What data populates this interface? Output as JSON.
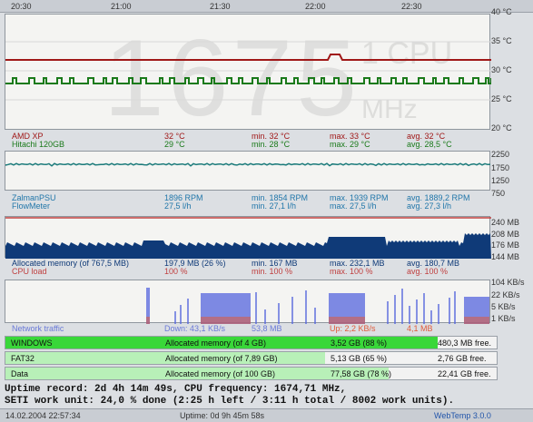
{
  "window": {
    "app_name": "WebTemp 3.0.0"
  },
  "time_axis": [
    "20:30",
    "21:00",
    "21:30",
    "22:00",
    "22:30"
  ],
  "colors": {
    "temp_amd": "#a01818",
    "temp_hitachi": "#1a7a1a",
    "fan": "#1a7a7a",
    "memory_fill": "#0f3a78",
    "cpu_load": "#c04040",
    "net_down": "#5566dd",
    "net_up": "#e05a3a",
    "drive_windows": "#39d739",
    "drive_fat32": "#b8f0b8",
    "drive_data": "#b8f0b8"
  },
  "temperature": {
    "scale": [
      "40 °C",
      "35 °C",
      "30 °C",
      "25 °C",
      "20 °C"
    ],
    "overlay_freq": "1675",
    "overlay_cpu": "1 CPU",
    "overlay_unit": "MHz",
    "rows": [
      {
        "name": "AMD XP",
        "current": "32 °C",
        "min": "min. 32 °C",
        "max": "max. 33 °C",
        "avg": "avg. 32 °C"
      },
      {
        "name": "Hitachi 120GB",
        "current": "29 °C",
        "min": "min. 28 °C",
        "max": "max. 29 °C",
        "avg": "avg. 28,5 °C"
      }
    ]
  },
  "fan": {
    "scale": [
      "2250",
      "1750",
      "1250",
      "750"
    ],
    "rows": [
      {
        "name": "ZalmanPSU",
        "current": "1896 RPM",
        "min": "min. 1854 RPM",
        "max": "max. 1939 RPM",
        "avg": "avg. 1889,2 RPM"
      },
      {
        "name": "FlowMeter",
        "current": "27,5 l/h",
        "min": "min. 27,1 l/h",
        "max": "max. 27,5 l/h",
        "avg": "avg. 27,3 l/h"
      }
    ]
  },
  "memory": {
    "scale": [
      "240 MB",
      "208 MB",
      "176 MB",
      "144 MB"
    ],
    "rows": [
      {
        "name": "Allocated memory (of 767,5 MB)",
        "current": "197,9 MB (26 %)",
        "min": "min. 167 MB",
        "max": "max. 232,1 MB",
        "avg": "avg. 180,7 MB"
      },
      {
        "name": "CPU load",
        "current": "100 %",
        "min": "min. 100 %",
        "max": "max. 100 %",
        "avg": "avg. 100 %"
      }
    ]
  },
  "network": {
    "scale": [
      "104 KB/s",
      "22 KB/s",
      "5 KB/s",
      "1 KB/s"
    ],
    "label": "Network traffic",
    "down": "Down: 43,1 KB/s",
    "down_max": "53,8 MB",
    "up": "Up: 2,2 KB/s",
    "up_max": "4,1 MB"
  },
  "drives": [
    {
      "name": "WINDOWS",
      "alloc": "Allocated memory (of 4 GB)",
      "used": "3,52 GB (88 %)",
      "free": "480,3 MB free.",
      "pct": 88
    },
    {
      "name": "FAT32",
      "alloc": "Allocated memory (of 7,89 GB)",
      "used": "5,13 GB (65 %)",
      "free": "2,76 GB free.",
      "pct": 65
    },
    {
      "name": "Data",
      "alloc": "Allocated memory (of 100 GB)",
      "used": "77,58 GB (78 %)",
      "free": "22,41 GB free.",
      "pct": 78
    }
  ],
  "status": {
    "uptime_record": "Uptime record: 2d 4h 14m 49s, CPU frequency: 1674,71 MHz,",
    "seti": "SETI work unit: 24,0 % done (2:25 h left / 3:11 h total / 8002 work units)."
  },
  "footer": {
    "datetime": "14.02.2004 22:57:34",
    "uptime": "Uptime: 0d 9h 45m 58s",
    "version": "WebTemp 3.0.0"
  }
}
